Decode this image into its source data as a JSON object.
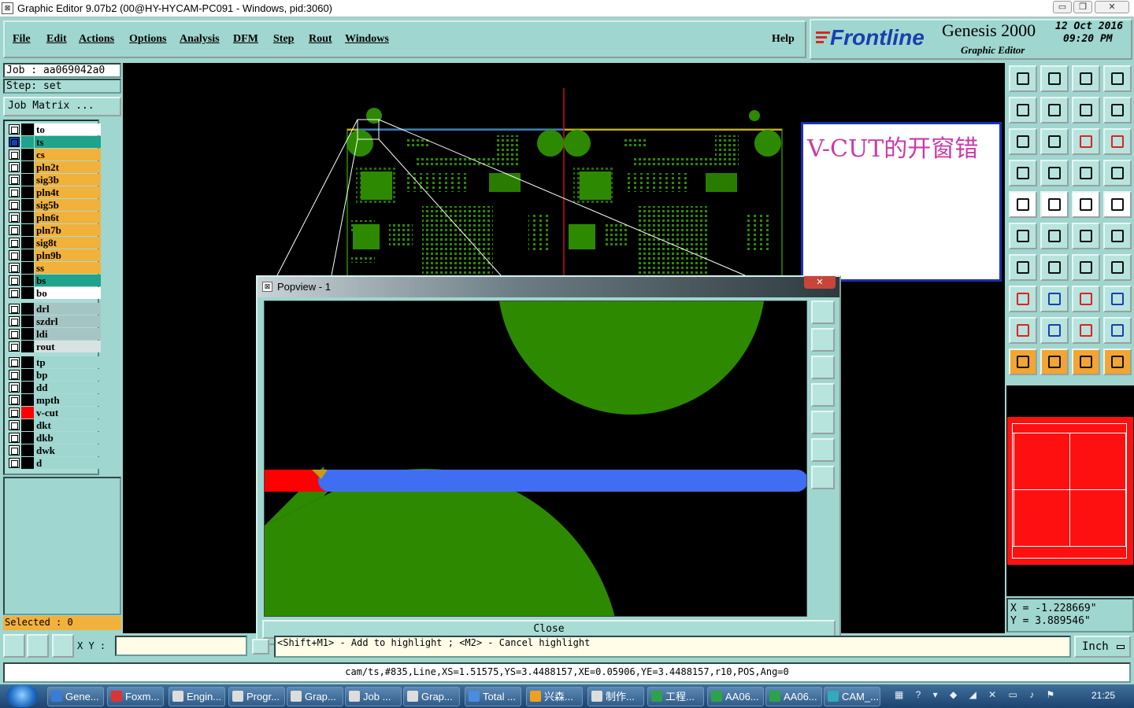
{
  "window": {
    "title": "Graphic Editor 9.07b2 (00@HY-HYCAM-PC091 - Windows, pid:3060)",
    "controls": {
      "minimize": "▭",
      "maximize": "❐",
      "close": "✕"
    }
  },
  "menu": [
    "File",
    "Edit",
    "Actions",
    "Options",
    "Analysis",
    "DFM",
    "Step",
    "Rout",
    "Windows"
  ],
  "help_label": "Help",
  "logo": {
    "brand": "Frontline",
    "product": "Genesis 2000",
    "subtitle": "Graphic Editor",
    "date": "12 Oct 2016",
    "time": "09:20 PM"
  },
  "job": {
    "job_text": "Job : aa069042a0",
    "step_text": "Step: set",
    "matrix_label": "Job Matrix ..."
  },
  "layers": [
    {
      "name": "to",
      "bg": "#ffffff",
      "marker": "#000000"
    },
    {
      "name": "ts",
      "bg": "#1fa38a",
      "marker": "#1fa38a",
      "active": true
    },
    {
      "name": "cs",
      "bg": "#f2b13a",
      "marker": "#000000"
    },
    {
      "name": "pln2t",
      "bg": "#f2b13a",
      "marker": "#000000"
    },
    {
      "name": "sig3b",
      "bg": "#f2b13a",
      "marker": "#000000"
    },
    {
      "name": "pln4t",
      "bg": "#f2b13a",
      "marker": "#000000"
    },
    {
      "name": "sig5b",
      "bg": "#f2b13a",
      "marker": "#000000"
    },
    {
      "name": "pln6t",
      "bg": "#f2b13a",
      "marker": "#000000"
    },
    {
      "name": "pln7b",
      "bg": "#f2b13a",
      "marker": "#000000"
    },
    {
      "name": "sig8t",
      "bg": "#f2b13a",
      "marker": "#000000"
    },
    {
      "name": "pln9b",
      "bg": "#f2b13a",
      "marker": "#000000"
    },
    {
      "name": "ss",
      "bg": "#f2b13a",
      "marker": "#000000"
    },
    {
      "name": "bs",
      "bg": "#1fa38a",
      "marker": "#000000"
    },
    {
      "name": "bo",
      "bg": "#ffffff",
      "marker": "#000000"
    },
    {
      "name": "drl",
      "bg": "#a7c4c4",
      "marker": "#000000",
      "gap": true
    },
    {
      "name": "szdrl",
      "bg": "#a7c4c4",
      "marker": "#000000"
    },
    {
      "name": "ldi",
      "bg": "#a7c4c4",
      "marker": "#000000"
    },
    {
      "name": "rout",
      "bg": "#d9e2e2",
      "marker": "#000000"
    },
    {
      "name": "tp",
      "bg": "#9fd6cf",
      "marker": "#000000",
      "gap": true
    },
    {
      "name": "bp",
      "bg": "#9fd6cf",
      "marker": "#000000"
    },
    {
      "name": "dd",
      "bg": "#9fd6cf",
      "marker": "#000000"
    },
    {
      "name": "mpth",
      "bg": "#9fd6cf",
      "marker": "#000000"
    },
    {
      "name": "v-cut",
      "bg": "#9fd6cf",
      "marker": "#ff0000"
    },
    {
      "name": "dkt",
      "bg": "#9fd6cf",
      "marker": "#000000"
    },
    {
      "name": "dkb",
      "bg": "#9fd6cf",
      "marker": "#000000"
    },
    {
      "name": "dwk",
      "bg": "#9fd6cf",
      "marker": "#000000"
    },
    {
      "name": "d",
      "bg": "#9fd6cf",
      "marker": "#000000"
    }
  ],
  "selected_text": "Selected : 0",
  "xy_label": "X Y :",
  "xy_value": "",
  "hint_text": "<Shift+M1> - Add to highlight ; <M2> - Cancel highlight",
  "units": "Inch",
  "coords": {
    "x": "X = -1.228669\"",
    "y": "Y = 3.889546\""
  },
  "annotation": "V-CUT的开窗错",
  "popview": {
    "title": "Popview - 1",
    "close_label": "Close"
  },
  "status_text": "cam/ts,#835,Line,XS=1.51575,YS=3.4488157,XE=0.05906,YE=3.4488157,r10,POS,Ang=0",
  "taskbar": {
    "items": [
      {
        "label": "Gene...",
        "color": "#3a7bd5"
      },
      {
        "label": "Foxm...",
        "color": "#d33"
      },
      {
        "label": "Engin...",
        "color": "#ddd"
      },
      {
        "label": "Progr...",
        "color": "#ddd"
      },
      {
        "label": "Grap...",
        "color": "#ddd"
      },
      {
        "label": "Job ...",
        "color": "#ddd"
      },
      {
        "label": "Grap...",
        "color": "#ddd"
      },
      {
        "label": "Total ...",
        "color": "#4a8de0"
      },
      {
        "label": "兴森...",
        "color": "#f0a020"
      },
      {
        "label": "制作...",
        "color": "#ddd"
      },
      {
        "label": "工程...",
        "color": "#2da24a"
      },
      {
        "label": "AA06...",
        "color": "#2da24a"
      },
      {
        "label": "AA06...",
        "color": "#2da24a"
      },
      {
        "label": "CAM_...",
        "color": "#3ab"
      }
    ],
    "clock": "21:25"
  },
  "colors": {
    "copper": "#2d8a00",
    "vcut": "#ff0000",
    "highlight": "#3f6ef2",
    "panel": "#9fd6cf"
  }
}
